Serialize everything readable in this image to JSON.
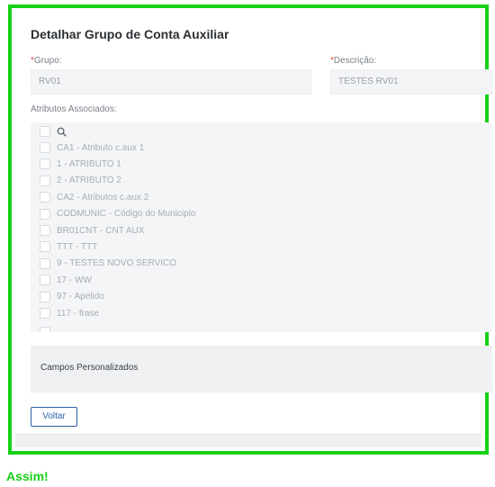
{
  "page": {
    "title": "Detalhar Grupo de Conta Auxiliar"
  },
  "form": {
    "grupo_label": "Grupo:",
    "grupo_value": "RV01",
    "descricao_label": "Descrição:",
    "descricao_value": "TESTES RV01",
    "required_marker": "*",
    "atributos_label": "Atributos Associados:"
  },
  "atributos": {
    "items": [
      "CA1 - Atributo c.aux 1",
      "1 - ATRIBUTO 1",
      "2 - ATRIBUTO 2",
      "CA2 - Atributos c.aux 2",
      "CODMUNIC - Código do Municipio",
      "BR01CNT - CNT AUX",
      "TTT - TTT",
      "9 - TESTES NOVO SERVICO",
      "17 - WW",
      "97 - Apelido",
      "117 - frase"
    ]
  },
  "custom_fields": {
    "label": "Campos Personalizados"
  },
  "actions": {
    "back_label": "Voltar"
  },
  "annotation": {
    "caption": "Assim!"
  },
  "colors": {
    "highlight_border": "#16d116",
    "button_border": "#2f5fa8",
    "required_marker": "#e8463b"
  }
}
